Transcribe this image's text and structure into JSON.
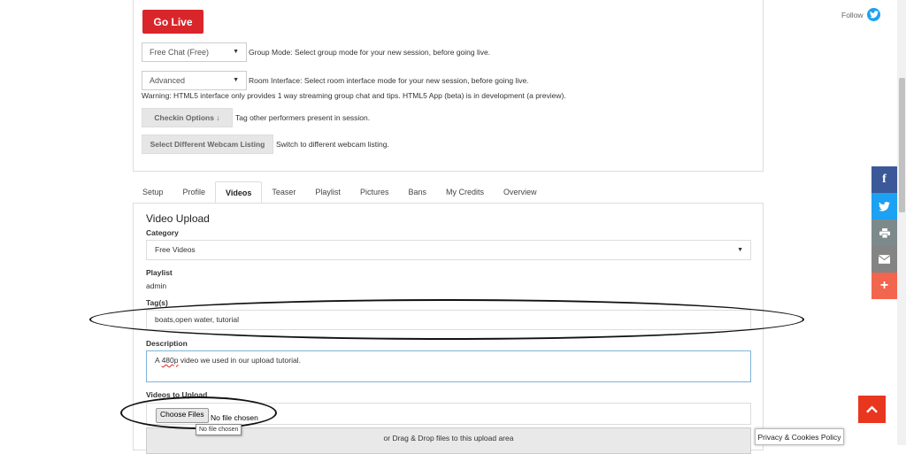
{
  "top": {
    "go_live_label": "Go Live",
    "group_mode": {
      "selected": "Free Chat (Free)",
      "help": "Group Mode: Select group mode for your new session, before going live."
    },
    "room_interface": {
      "selected": "Advanced",
      "help": "Room Interface: Select room interface mode for your new session, before going live."
    },
    "warning": "Warning: HTML5 interface only provides 1 way streaming group chat and tips. HTML5 App (beta) is in development (a preview).",
    "checkin": {
      "label": "Checkin Options ↓",
      "help": "Tag other performers present in session."
    },
    "webcam": {
      "label": "Select Different Webcam Listing",
      "help": "Switch to different webcam listing."
    }
  },
  "tabs": [
    {
      "label": "Setup"
    },
    {
      "label": "Profile"
    },
    {
      "label": "Videos"
    },
    {
      "label": "Teaser"
    },
    {
      "label": "Playlist"
    },
    {
      "label": "Pictures"
    },
    {
      "label": "Bans"
    },
    {
      "label": "My Credits"
    },
    {
      "label": "Overview"
    }
  ],
  "upload": {
    "heading": "Video Upload",
    "category_label": "Category",
    "category_value": "Free Videos",
    "playlist_label": "Playlist",
    "playlist_value": "admin",
    "tags_label": "Tag(s)",
    "tags_value": "boats,open water, tutorial",
    "description_label": "Description",
    "description_prefix": "A ",
    "description_misspelled": "480p",
    "description_suffix": " video we used in our upload tutorial.",
    "videos_label": "Videos to Upload",
    "choose_files_label": "Choose Files",
    "no_file_text": "No file chosen",
    "tooltip_text": "No file chosen",
    "dropzone_text": "or Drag & Drop files to this upload area"
  },
  "social": {
    "follow_label": "Follow",
    "share_buttons": [
      {
        "icon": "facebook-icon",
        "color": "#3b5998"
      },
      {
        "icon": "twitter-icon",
        "color": "#1da1f2"
      },
      {
        "icon": "print-icon",
        "color": "#7d8a8c"
      },
      {
        "icon": "email-icon",
        "color": "#848484"
      },
      {
        "icon": "plus-icon",
        "color": "#f2654f"
      }
    ]
  },
  "policy_label": "Privacy & Cookies Policy",
  "colors": {
    "accent_red": "#d9262b",
    "twitter_blue": "#1da1f2",
    "to_top_red": "#e8361f"
  }
}
